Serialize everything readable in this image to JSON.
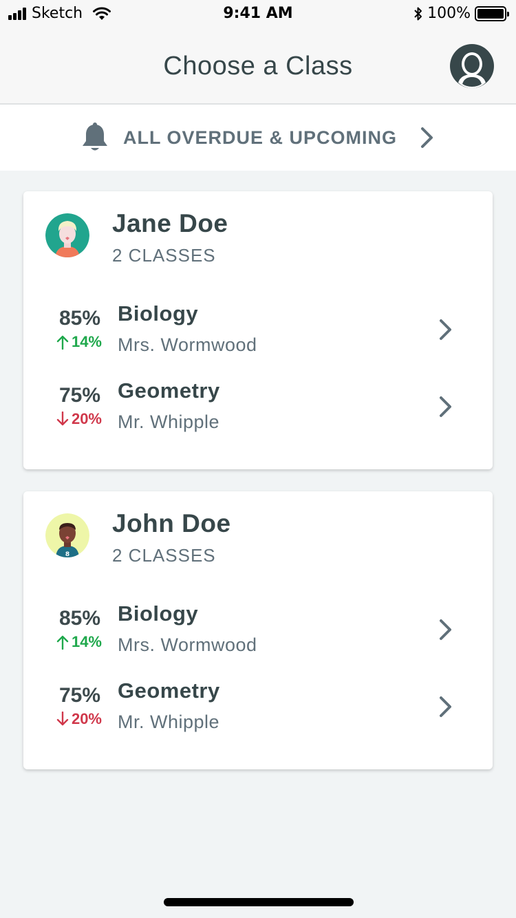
{
  "status_bar": {
    "carrier": "Sketch",
    "time": "9:41 AM",
    "battery_text": "100%",
    "battery_level": 1.0
  },
  "header": {
    "title": "Choose a Class",
    "profile_icon": "user-circle-icon"
  },
  "overdue": {
    "label": "ALL OVERDUE & UPCOMING",
    "icon": "bell-icon"
  },
  "colors": {
    "trend_up": "#1fa84c",
    "trend_down": "#d0384b",
    "primary_text": "#37474a",
    "secondary_text": "#60707a",
    "background": "#f1f4f5"
  },
  "students": [
    {
      "name": "Jane Doe",
      "class_count": "2 CLASSES",
      "avatar_bg": "#21a58e",
      "classes": [
        {
          "grade": "85%",
          "trend": "14%",
          "trend_direction": "up",
          "class_name": "Biology",
          "teacher": "Mrs. Wormwood"
        },
        {
          "grade": "75%",
          "trend": "20%",
          "trend_direction": "down",
          "class_name": "Geometry",
          "teacher": "Mr. Whipple"
        }
      ]
    },
    {
      "name": "John Doe",
      "class_count": "2 CLASSES",
      "avatar_bg": "#eef6a8",
      "avatar_jersey_number": "8",
      "classes": [
        {
          "grade": "85%",
          "trend": "14%",
          "trend_direction": "up",
          "class_name": "Biology",
          "teacher": "Mrs. Wormwood"
        },
        {
          "grade": "75%",
          "trend": "20%",
          "trend_direction": "down",
          "class_name": "Geometry",
          "teacher": "Mr. Whipple"
        }
      ]
    }
  ]
}
